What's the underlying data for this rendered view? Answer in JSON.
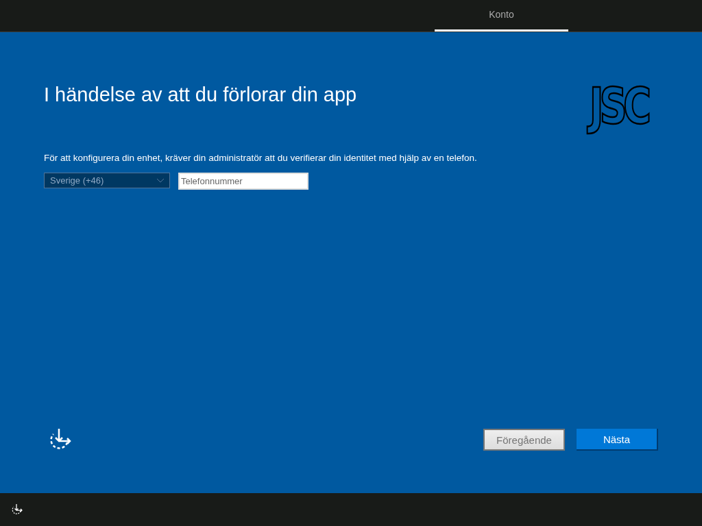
{
  "header": {
    "tabs": [
      {
        "label": "Konto",
        "selected": true
      }
    ]
  },
  "logo": {
    "text": "JSC"
  },
  "title": "I händelse av att du förlorar din app",
  "description": "För att konfigurera din enhet, kräver din administratör att du verifierar din identitet med hjälp av en telefon.",
  "country_select": {
    "value": "Sverige (+46)"
  },
  "phone_field": {
    "placeholder": "Telefonnummer"
  },
  "buttons": [
    {
      "label": "Föregående",
      "kind": "secondary",
      "disabled": true
    },
    {
      "label": "Nästa",
      "kind": "primary",
      "disabled": false
    }
  ]
}
